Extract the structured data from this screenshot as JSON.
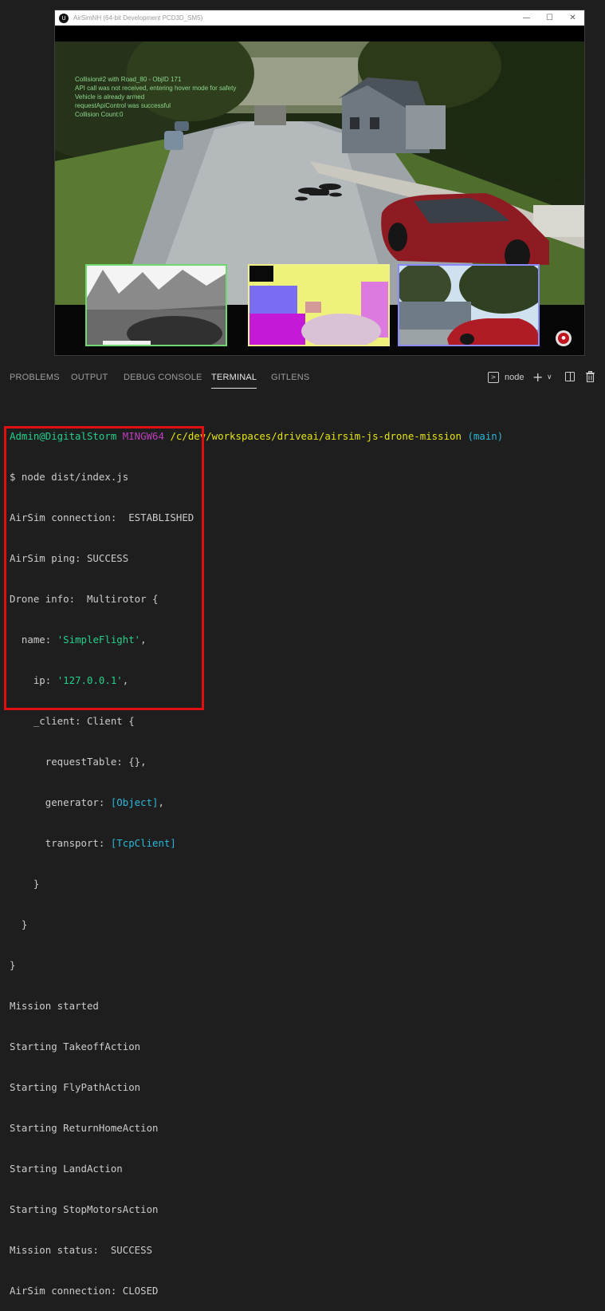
{
  "sim": {
    "logo": "U",
    "title": "AirSimNH (64-bit Development PCD3D_SM5)",
    "controls": {
      "minimize": "—",
      "maximize": "☐",
      "close": "✕"
    },
    "overlay": [
      "Collision#2 with Road_80 - ObjID 171",
      "API call was not received, entering hover mode for safety",
      "Vehicle is already armed",
      "requestApiControl was successful",
      "Collision Count:0"
    ]
  },
  "panel": {
    "tabs": [
      "PROBLEMS",
      "OUTPUT",
      "DEBUG CONSOLE",
      "TERMINAL",
      "GITLENS"
    ],
    "active_tab": "TERMINAL",
    "terminal_name": "node",
    "icons": [
      "terminal-icon",
      "plus-icon",
      "chevron-down-icon",
      "split-icon",
      "trash-icon"
    ]
  },
  "terminal": {
    "prompt": {
      "user": "Admin@DigitalStorm",
      "host": "MINGW64",
      "path": "/c/dev/workspaces/driveai/airsim-js-drone-mission",
      "branch": "(main)"
    },
    "command": "$ node dist/index.js",
    "output": {
      "connection": "AirSim connection:  ESTABLISHED",
      "ping": "AirSim ping: SUCCESS",
      "drone_info": "Drone info:  Multirotor {",
      "name_key": "  name: ",
      "name_val": "'SimpleFlight'",
      "name_end": ",",
      "ip_key": "    ip: ",
      "ip_val": "'127.0.0.1'",
      "ip_end": ",",
      "client": "    _client: Client {",
      "request_table": "      requestTable: {},",
      "generator_key": "      generator: ",
      "generator_val": "[Object]",
      "generator_end": ",",
      "transport_key": "      transport: ",
      "transport_val": "[TcpClient]",
      "close1": "    }",
      "close2": "  }",
      "close3": "}",
      "steps": [
        "Mission started",
        "Starting TakeoffAction",
        "Starting FlyPathAction",
        "Starting ReturnHomeAction",
        "Starting LandAction",
        "Starting StopMotorsAction",
        "Mission status:  SUCCESS",
        "AirSim connection: CLOSED"
      ]
    }
  },
  "colors": {
    "highlight_box": "#e01010",
    "prompt_user": "#23d18b",
    "prompt_host": "#bc3fbc",
    "prompt_path": "#e5e510",
    "prompt_branch": "#29b8db"
  }
}
